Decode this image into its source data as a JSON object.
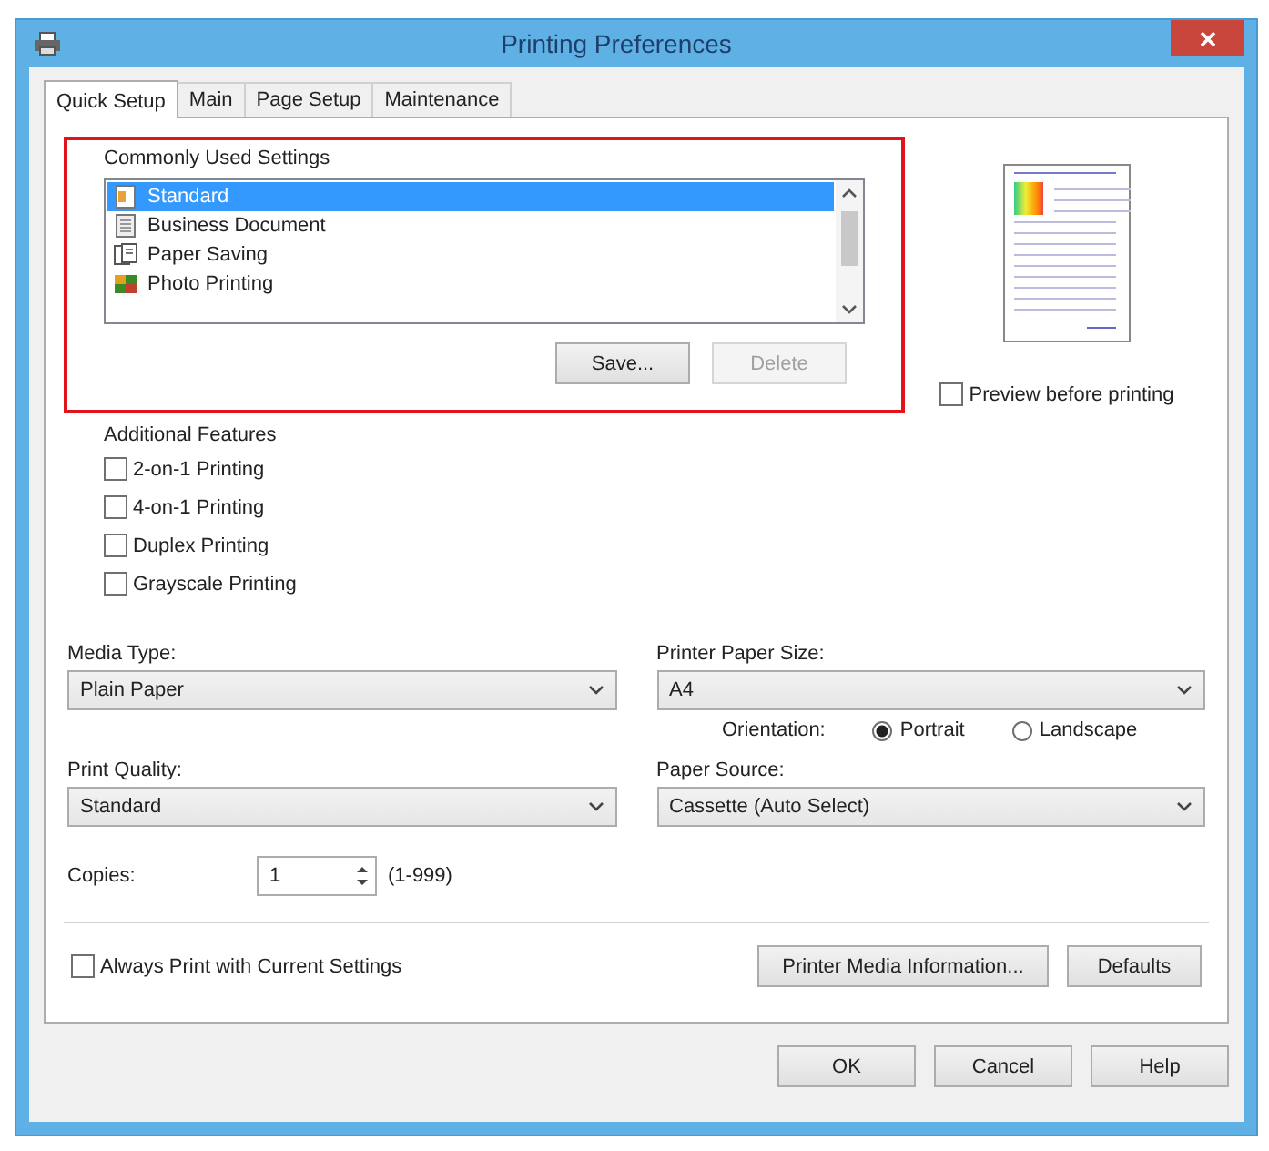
{
  "window": {
    "title": "Printing Preferences"
  },
  "tabs": [
    {
      "label": "Quick Setup",
      "selected": true
    },
    {
      "label": "Main",
      "selected": false
    },
    {
      "label": "Page Setup",
      "selected": false
    },
    {
      "label": "Maintenance",
      "selected": false
    }
  ],
  "commonly_used_settings": {
    "label": "Commonly Used Settings",
    "items": [
      {
        "label": "Standard",
        "selected": true,
        "kind": "standard"
      },
      {
        "label": "Business Document",
        "selected": false,
        "kind": "document"
      },
      {
        "label": "Paper Saving",
        "selected": false,
        "kind": "saving"
      },
      {
        "label": "Photo Printing",
        "selected": false,
        "kind": "photo"
      }
    ],
    "buttons": [
      {
        "label": "Save...",
        "disabled": false
      },
      {
        "label": "Delete",
        "disabled": true
      }
    ]
  },
  "preview": {
    "label": "Preview before printing",
    "checked": false
  },
  "additional_features": {
    "label": "Additional Features",
    "options": [
      {
        "label": "2-on-1 Printing",
        "checked": false
      },
      {
        "label": "4-on-1 Printing",
        "checked": false
      },
      {
        "label": "Duplex Printing",
        "checked": false
      },
      {
        "label": "Grayscale Printing",
        "checked": false
      }
    ]
  },
  "media_type": {
    "label": "Media Type:",
    "value": "Plain Paper"
  },
  "printer_paper_size": {
    "label": "Printer Paper Size:",
    "value": "A4"
  },
  "orientation": {
    "label": "Orientation:",
    "options": [
      {
        "label": "Portrait",
        "selected": true
      },
      {
        "label": "Landscape",
        "selected": false
      }
    ]
  },
  "print_quality": {
    "label": "Print Quality:",
    "value": "Standard"
  },
  "paper_source": {
    "label": "Paper Source:",
    "value": "Cassette (Auto Select)"
  },
  "copies": {
    "label": "Copies:",
    "value": "1",
    "range": "(1-999)"
  },
  "always_print": {
    "label": "Always Print with Current Settings",
    "checked": false
  },
  "panel_buttons": [
    "Printer Media Information...",
    "Defaults"
  ],
  "dialog_buttons": [
    "OK",
    "Cancel",
    "Help"
  ]
}
